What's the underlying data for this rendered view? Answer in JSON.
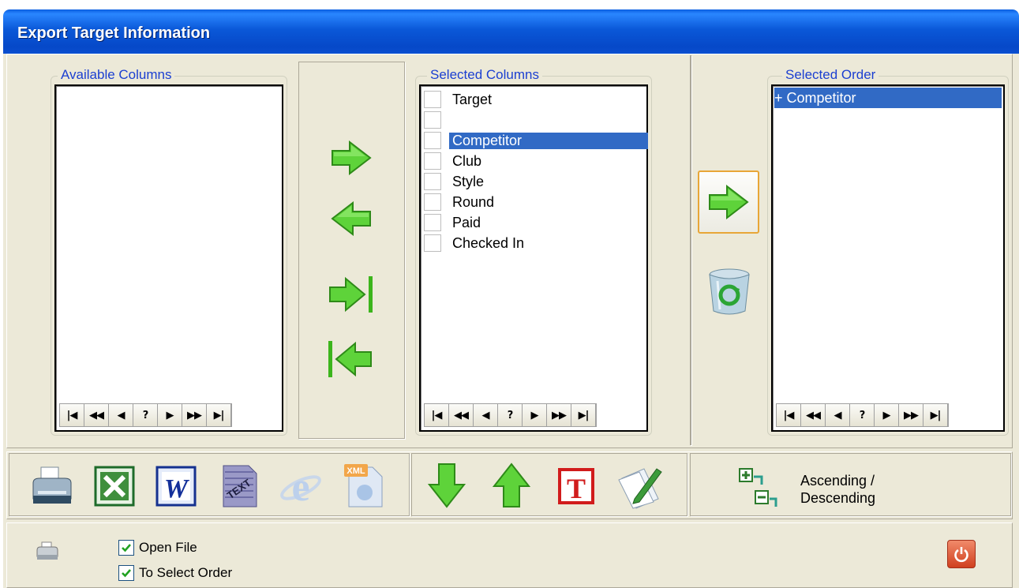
{
  "window": {
    "title": "Export Target Information"
  },
  "groups": {
    "available": {
      "label": "Available Columns",
      "items": []
    },
    "selected": {
      "label": "Selected Columns",
      "items": [
        {
          "label": "Target",
          "selected": false
        },
        {
          "label": "",
          "selected": false
        },
        {
          "label": "Competitor",
          "selected": true
        },
        {
          "label": "Club",
          "selected": false
        },
        {
          "label": "Style",
          "selected": false
        },
        {
          "label": "Round",
          "selected": false
        },
        {
          "label": "Paid",
          "selected": false
        },
        {
          "label": "Checked In",
          "selected": false
        }
      ]
    },
    "order": {
      "label": "Selected Order",
      "items": [
        {
          "label": "+ Competitor",
          "selected": true
        }
      ]
    }
  },
  "navigator": {
    "buttons": [
      "|◀",
      "◀◀",
      "◀",
      "?",
      "▶",
      "▶▶",
      "▶|"
    ]
  },
  "sort": {
    "label_line1": "Ascending /",
    "label_line2": "Descending"
  },
  "options": {
    "open_file": "Open File",
    "to_select_order": "To Select Order"
  },
  "colors": {
    "accent": "#316ac5",
    "arrow_green": "#4ac62c",
    "title_blue": "#0a58d8"
  }
}
